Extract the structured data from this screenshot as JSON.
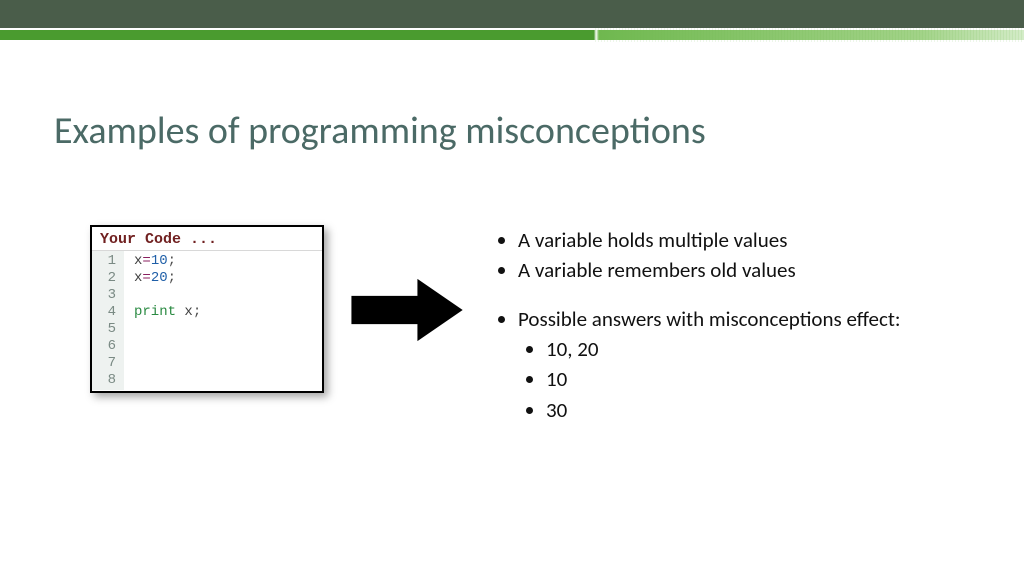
{
  "title": "Examples of programming misconceptions",
  "code": {
    "header": "Your Code ...",
    "lines": {
      "ln1": "1",
      "ln2": "2",
      "ln3": "3",
      "ln4": "4",
      "ln5": "5",
      "ln6": "6",
      "ln7": "7",
      "ln8": "8"
    },
    "l1": {
      "var": "x",
      "op": "=",
      "num": "10",
      "end": ";"
    },
    "l2": {
      "var": "x",
      "op": "=",
      "num": "20",
      "end": ";"
    },
    "l4": {
      "kw": "print",
      "sp": " ",
      "var": "x",
      "end": ";"
    }
  },
  "bullets": {
    "b1": "A variable holds multiple values",
    "b2": "A variable remembers old values",
    "b3": "Possible answers with misconceptions effect:",
    "ans": {
      "a1": "10, 20",
      "a2": "10",
      "a3": "30"
    }
  }
}
